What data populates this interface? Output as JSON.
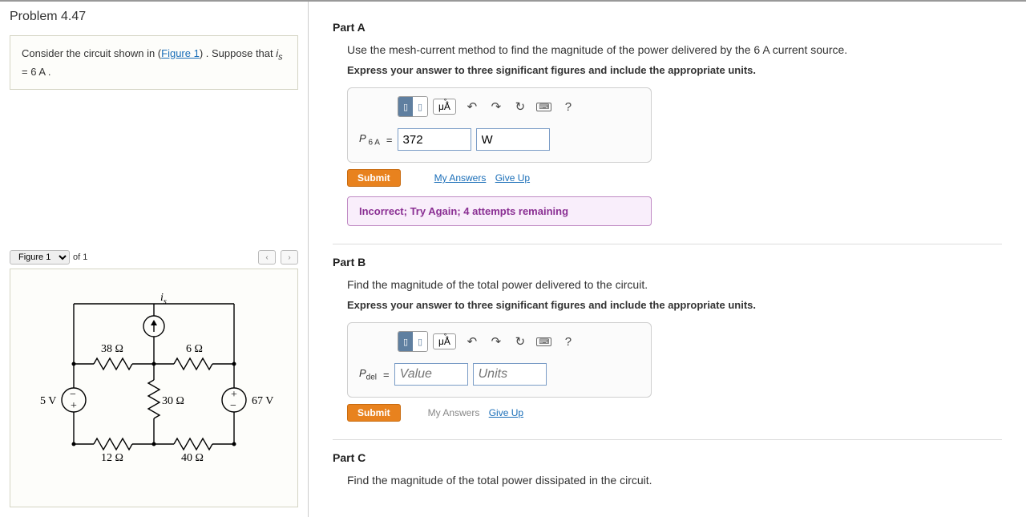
{
  "problem": {
    "title": "Problem 4.47",
    "prompt_pre": "Consider the circuit shown in (",
    "prompt_link": "Figure 1",
    "prompt_post": ") . Suppose that ",
    "prompt_var": "i",
    "prompt_sub": "s",
    "prompt_eq": " = 6  A ."
  },
  "figure": {
    "selector": "Figure 1",
    "count": "of 1",
    "prev": "‹",
    "next": "›",
    "labels": {
      "is": "i",
      "is_sub": "s",
      "r38": "38 Ω",
      "r6": "6 Ω",
      "r30": "30 Ω",
      "r12": "12 Ω",
      "r40": "40 Ω",
      "v5": "5 V",
      "v67": "67 V",
      "plus": "+",
      "minus": "−"
    }
  },
  "partA": {
    "title": "Part A",
    "question_pre": "Use the mesh-current method to find the magnitude of the power delivered by the 6 ",
    "question_unit": "A",
    "question_post": " current source.",
    "instruction": "Express your answer to three significant figures and include the appropriate units.",
    "label_pre": "P",
    "label_sub": " 6 A",
    "eq": "=",
    "value": "372",
    "units": "W",
    "submit": "Submit",
    "my_answers": "My Answers",
    "give_up": "Give Up",
    "feedback": "Incorrect; Try Again; 4 attempts remaining"
  },
  "partB": {
    "title": "Part B",
    "question": "Find the magnitude of the total power delivered to the circuit.",
    "instruction": "Express your answer to three significant figures and include the appropriate units.",
    "label_pre": "P",
    "label_sub": "del",
    "eq": "=",
    "value_ph": "Value",
    "units_ph": "Units",
    "submit": "Submit",
    "my_answers": "My Answers",
    "give_up": "Give Up"
  },
  "partC": {
    "title": "Part C",
    "question": "Find the magnitude of the total power dissipated in the circuit."
  },
  "toolbar": {
    "mua": "μÅ",
    "undo": "↶",
    "redo": "↷",
    "reset": "↻",
    "kb": "⌨",
    "help": "?"
  }
}
